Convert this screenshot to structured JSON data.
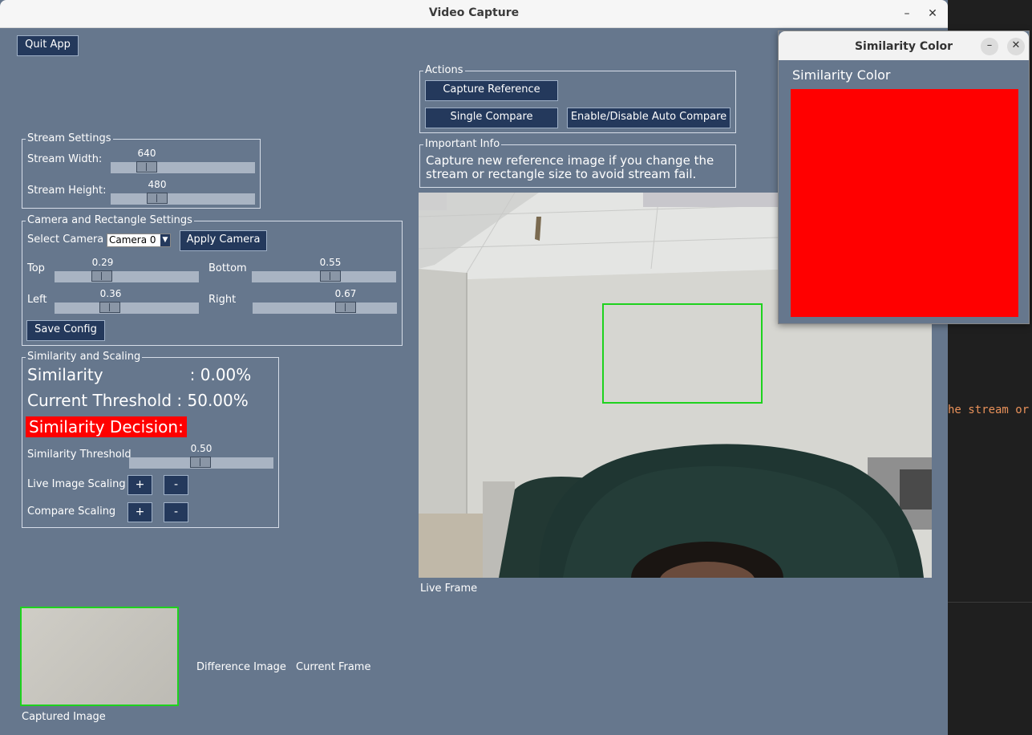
{
  "window": {
    "title": "Video Capture"
  },
  "toolbar": {
    "quit_label": "Quit App"
  },
  "stream_settings": {
    "title": "Stream Settings",
    "width_label": "Stream Width:",
    "width_value": "640",
    "height_label": "Stream Height:",
    "height_value": "480"
  },
  "camera_settings": {
    "title": "Camera and Rectangle Settings",
    "select_label": "Select Camera",
    "camera_selected": "Camera 0",
    "apply_label": "Apply Camera",
    "top_label": "Top",
    "top_value": "0.29",
    "bottom_label": "Bottom",
    "bottom_value": "0.55",
    "left_label": "Left",
    "left_value": "0.36",
    "right_label": "Right",
    "right_value": "0.67",
    "save_label": "Save Config"
  },
  "similarity": {
    "title": "Similarity and Scaling",
    "similarity_text": "Similarity                 : 0.00%",
    "threshold_text": "Current Threshold : 50.00%",
    "decision_text": "Similarity Decision:",
    "slider_label": "Similarity Threshold",
    "slider_value": "0.50",
    "live_scaling_label": "Live Image Scaling",
    "compare_scaling_label": "Compare Scaling",
    "plus": "+",
    "minus": "-"
  },
  "actions": {
    "title": "Actions",
    "capture_ref_label": "Capture Reference",
    "single_compare_label": "Single Compare",
    "auto_compare_label": "Enable/Disable Auto Compare"
  },
  "info": {
    "title": "Important Info",
    "line1": "Capture new reference image if you change the",
    "line2": "stream or rectangle size to avoid stream fail."
  },
  "frames": {
    "live_label": "Live Frame",
    "captured_label": "Captured Image",
    "difference_label": "Difference Image",
    "current_label": "Current Frame"
  },
  "popup": {
    "title": "Similarity Color",
    "label": "Similarity Color",
    "color": "#ff0000"
  },
  "terminal": {
    "text": "he stream or"
  },
  "colors": {
    "accent_green": "#1ed21e",
    "window_bg": "#66778d",
    "button_bg": "#24395c"
  }
}
